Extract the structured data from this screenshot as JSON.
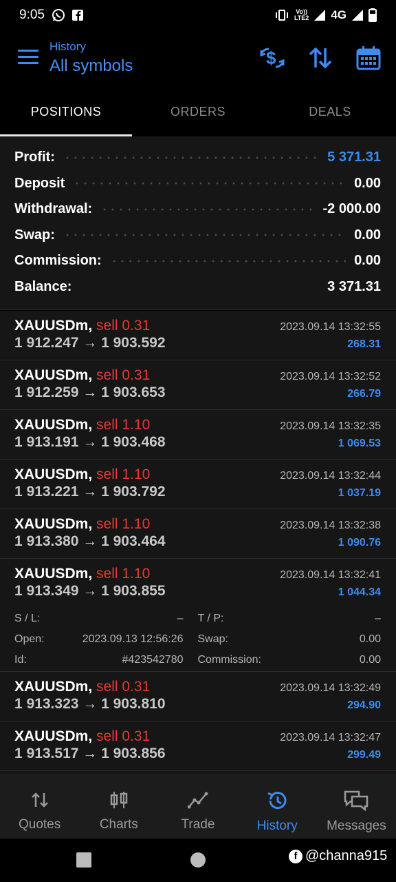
{
  "status_bar": {
    "time": "9:05",
    "volte_top": "Vo))",
    "volte_bottom": "LTE2",
    "network": "4G"
  },
  "header": {
    "subtitle": "History",
    "title": "All symbols"
  },
  "tabs": [
    {
      "label": "POSITIONS",
      "active": true
    },
    {
      "label": "ORDERS",
      "active": false
    },
    {
      "label": "DEALS",
      "active": false
    }
  ],
  "summary": [
    {
      "label": "Profit:",
      "value": "5 371.31"
    },
    {
      "label": "Deposit",
      "value": "0.00"
    },
    {
      "label": "Withdrawal:",
      "value": "-2 000.00"
    },
    {
      "label": "Swap:",
      "value": "0.00"
    },
    {
      "label": "Commission:",
      "value": "0.00"
    },
    {
      "label": "Balance:",
      "value": "3 371.31"
    }
  ],
  "deals": [
    {
      "symbol": "XAUUSDm,",
      "side": "sell 0.31",
      "prices": "1 912.247 → 1 903.592",
      "time": "2023.09.14 13:32:55",
      "profit": "268.31"
    },
    {
      "symbol": "XAUUSDm,",
      "side": "sell 0.31",
      "prices": "1 912.259 → 1 903.653",
      "time": "2023.09.14 13:32:52",
      "profit": "266.79"
    },
    {
      "symbol": "XAUUSDm,",
      "side": "sell 1.10",
      "prices": "1 913.191 → 1 903.468",
      "time": "2023.09.14 13:32:35",
      "profit": "1 069.53"
    },
    {
      "symbol": "XAUUSDm,",
      "side": "sell 1.10",
      "prices": "1 913.221 → 1 903.792",
      "time": "2023.09.14 13:32:44",
      "profit": "1 037.19"
    },
    {
      "symbol": "XAUUSDm,",
      "side": "sell 1.10",
      "prices": "1 913.380 → 1 903.464",
      "time": "2023.09.14 13:32:38",
      "profit": "1 090.76"
    },
    {
      "symbol": "XAUUSDm,",
      "side": "sell 1.10",
      "prices": "1 913.349 → 1 903.855",
      "time": "2023.09.14 13:32:41",
      "profit": "1 044.34",
      "details": {
        "sl_label": "S / L:",
        "sl_value": "–",
        "tp_label": "T / P:",
        "tp_value": "–",
        "open_label": "Open:",
        "open_value": "2023.09.13 12:56:26",
        "swap_label": "Swap:",
        "swap_value": "0.00",
        "id_label": "Id:",
        "id_value": "#423542780",
        "commission_label": "Commission:",
        "commission_value": "0.00"
      }
    },
    {
      "symbol": "XAUUSDm,",
      "side": "sell 0.31",
      "prices": "1 913.323 → 1 903.810",
      "time": "2023.09.14 13:32:49",
      "profit": "294.90"
    },
    {
      "symbol": "XAUUSDm,",
      "side": "sell 0.31",
      "prices": "1 913.517 → 1 903.856",
      "time": "2023.09.14 13:32:47",
      "profit": "299.49"
    }
  ],
  "bottom_nav": [
    {
      "label": "Quotes",
      "icon": "quotes-icon",
      "active": false
    },
    {
      "label": "Charts",
      "icon": "charts-icon",
      "active": false
    },
    {
      "label": "Trade",
      "icon": "trade-icon",
      "active": false
    },
    {
      "label": "History",
      "icon": "history-icon",
      "active": true
    },
    {
      "label": "Messages",
      "icon": "messages-icon",
      "active": false
    }
  ],
  "watermark": "@channa915",
  "colors": {
    "accent": "#3d8bf0",
    "sell": "#e53935",
    "background": "#000000",
    "panel": "#161616"
  }
}
